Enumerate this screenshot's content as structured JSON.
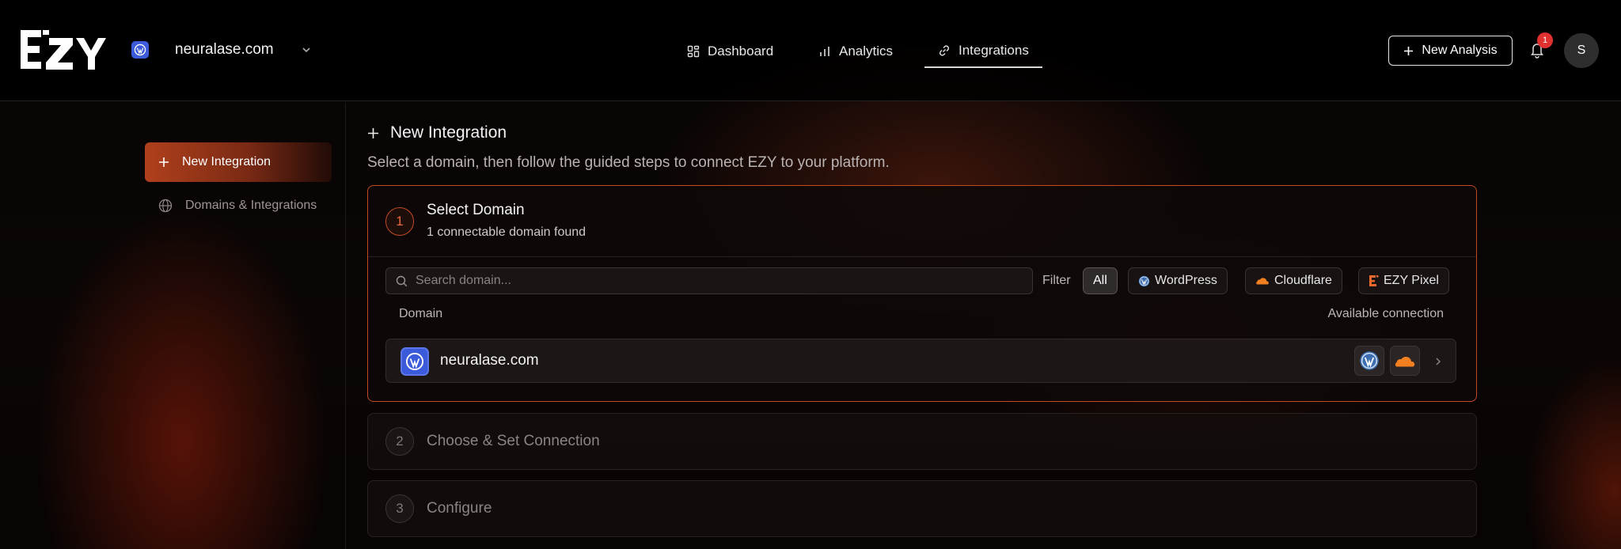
{
  "header": {
    "brand": "EZY",
    "site_name": "neuralase.com",
    "nav": [
      {
        "label": "Dashboard",
        "icon": "grid-icon"
      },
      {
        "label": "Analytics",
        "icon": "bar-chart-icon"
      },
      {
        "label": "Integrations",
        "icon": "link-icon",
        "active": true
      }
    ],
    "new_analysis_label": "New Analysis",
    "notification_count": "1",
    "avatar_initial": "S"
  },
  "sidebar": {
    "items": [
      {
        "label": "New Integration",
        "icon": "plus-icon",
        "active": true
      },
      {
        "label": "Domains & Integrations",
        "icon": "globe-icon"
      }
    ]
  },
  "main": {
    "title": "New Integration",
    "subtitle": "Select a domain, then follow the guided steps to connect EZY to your platform.",
    "steps": [
      {
        "number": "1",
        "title": "Select Domain",
        "subtitle": "1 connectable domain found"
      },
      {
        "number": "2",
        "title": "Choose & Set Connection"
      },
      {
        "number": "3",
        "title": "Configure"
      }
    ],
    "search_placeholder": "Search domain...",
    "filter_label": "Filter",
    "filters": [
      "All",
      "WordPress",
      "Cloudflare",
      "EZY Pixel"
    ],
    "columns": {
      "domain": "Domain",
      "available": "Available connection"
    },
    "rows": [
      {
        "domain": "neuralase.com",
        "connections": [
          "wordpress-icon",
          "cloudflare-icon"
        ]
      }
    ]
  },
  "colors": {
    "accent": "#c24a22",
    "wordpress_blue": "#3b5bdb",
    "cloudflare_orange": "#f38020",
    "badge_red": "#e03131"
  }
}
